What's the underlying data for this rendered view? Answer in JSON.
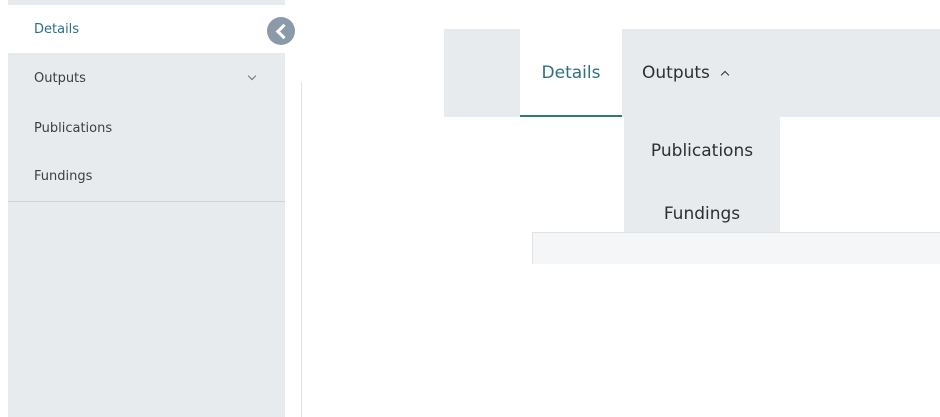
{
  "side_nav": {
    "items": [
      {
        "label": "Details",
        "active": true
      },
      {
        "label": "Outputs",
        "expanded": false,
        "icon": "chevron-down-icon"
      },
      {
        "label": "Publications"
      },
      {
        "label": "Fundings"
      }
    ],
    "collapse_icon": "chevron-left-icon"
  },
  "tab_bar": {
    "tabs": [
      {
        "label": "Details",
        "active": true
      },
      {
        "label": "Outputs",
        "expanded": true,
        "icon": "chevron-up-icon"
      }
    ],
    "dropdown": {
      "items": [
        {
          "label": "Publications"
        },
        {
          "label": "Fundings"
        }
      ]
    }
  },
  "colors": {
    "accent": "#2f7a6e",
    "active_text": "#2c6f8a",
    "panel_bg": "#e8ebed",
    "collapse_button": "#8a9aa8"
  }
}
